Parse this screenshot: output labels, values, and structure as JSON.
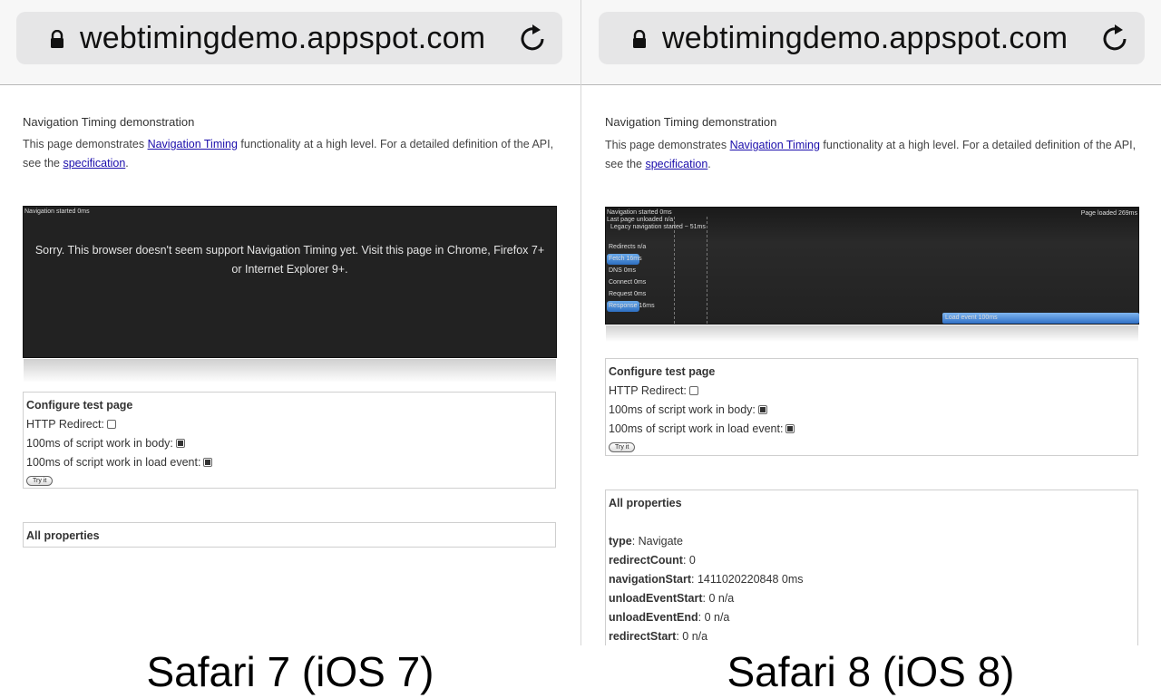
{
  "left": {
    "url": "webtimingdemo.appspot.com",
    "page_title": "Navigation Timing demonstration",
    "intro_before": "This page demonstrates ",
    "intro_link1": "Navigation Timing",
    "intro_mid": " functionality at a high level. For a detailed definition of the API, see the ",
    "intro_link2": "specification",
    "intro_after": ".",
    "timeline_start": "Navigation started 0ms",
    "sorry": "Sorry. This browser doesn't seem support Navigation Timing yet. Visit this page in Chrome, Firefox 7+ or Internet Explorer 9+.",
    "config_title": "Configure test page",
    "opt_redirect": "HTTP Redirect:",
    "opt_body": "100ms of script work in body:",
    "opt_load": "100ms of script work in load event:",
    "try_button": "Try it",
    "props_title": "All properties",
    "caption": "Safari 7 (iOS 7)"
  },
  "right": {
    "url": "webtimingdemo.appspot.com",
    "page_title": "Navigation Timing demonstration",
    "intro_before": "This page demonstrates ",
    "intro_link1": "Navigation Timing",
    "intro_mid": " functionality at a high level. For a detailed definition of the API, see the ",
    "intro_link2": "specification",
    "intro_after": ".",
    "timeline": {
      "nav_started": "Navigation started 0ms",
      "last_unload": "Last page unloaded n/a",
      "legacy": "Legacy navigation started ~ 51ms",
      "page_loaded": "Page loaded 269ms",
      "redirects": "Redirects n/a",
      "fetch_label": "Fetch",
      "fetch_value": "16ms",
      "dns": "DNS 0ms",
      "connect": "Connect 0ms",
      "request": "Request 0ms",
      "response_label": "Response",
      "response_value": "16ms",
      "load_event": "Load event 100ms"
    },
    "config_title": "Configure test page",
    "opt_redirect": "HTTP Redirect:",
    "opt_body": "100ms of script work in body:",
    "opt_load": "100ms of script work in load event:",
    "try_button": "Try it",
    "props_title": "All properties",
    "properties": [
      {
        "name": "type",
        "value": ": Navigate"
      },
      {
        "name": "redirectCount",
        "value": ": 0"
      },
      {
        "name": "navigationStart",
        "value": ": 1411020220848 0ms"
      },
      {
        "name": "unloadEventStart",
        "value": ": 0 n/a"
      },
      {
        "name": "unloadEventEnd",
        "value": ": 0 n/a"
      },
      {
        "name": "redirectStart",
        "value": ": 0 n/a"
      }
    ],
    "caption": "Safari 8 (iOS 8)"
  },
  "checkbox_states": {
    "redirect": false,
    "body": true,
    "load": true
  }
}
